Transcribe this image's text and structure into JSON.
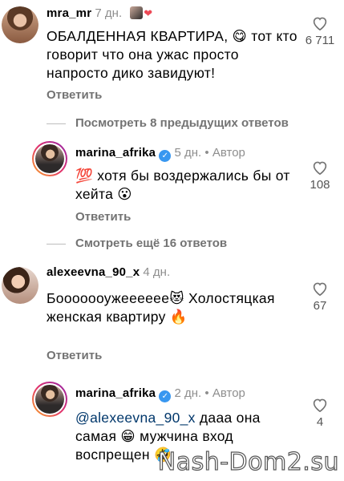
{
  "comments": [
    {
      "username": "mra_mr",
      "time": "7 дн.",
      "text": "ОБАЛДЕННАЯ КВАРТИРА, 😋 тот кто говорит что она ужас просто напросто дико завидуют!",
      "likes": "6 711",
      "reply_label": "Ответить"
    },
    {
      "username": "marina_afrika",
      "time": "5 дн.",
      "author_label": "Автор",
      "text": "💯 хотя бы воздержались бы от хейта 😮",
      "likes": "108",
      "reply_label": "Ответить"
    },
    {
      "username": "alexeevna_90_x",
      "time": "4 дн.",
      "text": "Бооооооужееееее😻 Холостяцкая женская квартиру 🔥",
      "likes": "67",
      "reply_label": "Ответить"
    },
    {
      "username": "marina_afrika",
      "time": "2 дн.",
      "author_label": "Автор",
      "mention": "@alexeevna_90_x",
      "text": " дааа она самая 😁 мужчина  вход воспрещен 🤣",
      "likes": "4"
    }
  ],
  "threads": {
    "previous": "Посмотреть 8 предыдущих ответов",
    "more": "Смотреть ещё 16 ответов"
  },
  "separator": "•",
  "watermark": "Nash-Dom2.su",
  "icons": {
    "like": "heart-outline-icon",
    "verified": "verified-badge-icon"
  }
}
